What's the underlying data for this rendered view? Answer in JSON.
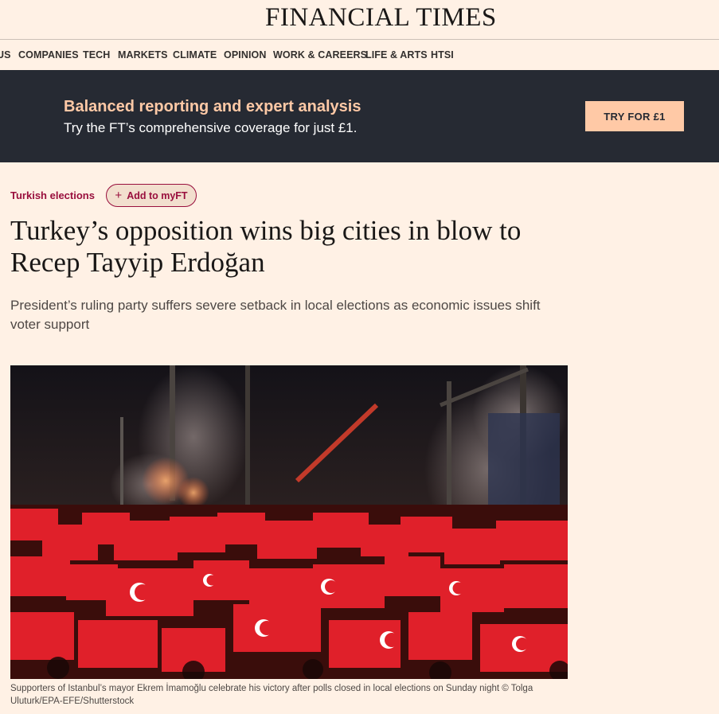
{
  "masthead": {
    "logo_text": "FINANCIAL TIMES"
  },
  "nav": {
    "items": [
      {
        "label": "US"
      },
      {
        "label": "COMPANIES"
      },
      {
        "label": "TECH"
      },
      {
        "label": "MARKETS"
      },
      {
        "label": "CLIMATE"
      },
      {
        "label": "OPINION"
      },
      {
        "label": "WORK & CAREERS"
      },
      {
        "label": "LIFE & ARTS"
      },
      {
        "label": "HTSI"
      }
    ]
  },
  "banner": {
    "headline": "Balanced reporting and expert analysis",
    "subtext": "Try the FT’s comprehensive coverage for just £1.",
    "cta_label": "TRY FOR £1",
    "background_color": "#262a33",
    "accent_color": "#ffc9a6"
  },
  "article": {
    "topic": "Turkish elections",
    "myft_label": "Add to myFT",
    "title": "Turkey’s opposition wins big cities in blow to Recep Tayyip Erdoğan",
    "standfirst": "President’s ruling party suffers severe setback in local elections as economic issues shift voter support",
    "image_caption": "Supporters of Istanbul’s mayor Ekrem İmamoğlu celebrate his victory after polls closed in local elections on Sunday night © Tolga Uluturk/EPA-EFE/Shutterstock",
    "topic_color": "#990f3d"
  }
}
